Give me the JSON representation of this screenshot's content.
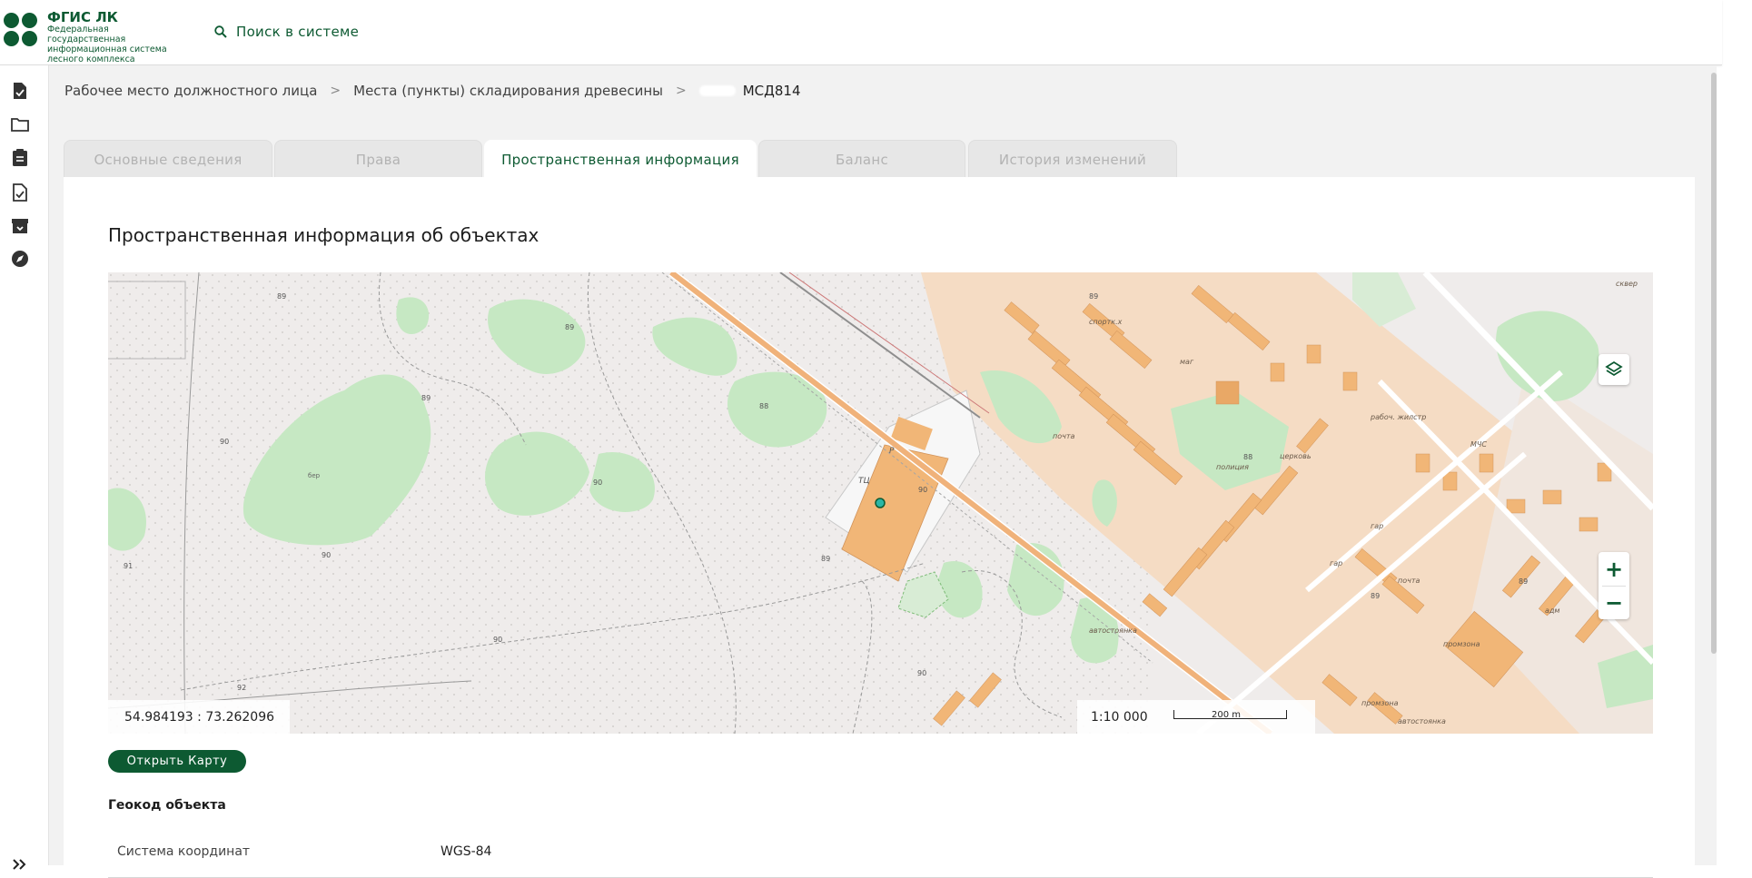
{
  "header": {
    "logo_title": "ФГИС ЛК",
    "logo_subtitle": "Федеральная государственная информационная система лесного комплекса",
    "search_label": "Поиск в системе"
  },
  "breadcrumb": {
    "items": [
      "Рабочее место должностного лица",
      "Места (пункты) складирования древесины"
    ],
    "current": "МСД814"
  },
  "tabs": [
    {
      "label": "Основные сведения",
      "active": false
    },
    {
      "label": "Права",
      "active": false
    },
    {
      "label": "Пространственная информация",
      "active": true
    },
    {
      "label": "Баланс",
      "active": false
    },
    {
      "label": "История изменений",
      "active": false
    }
  ],
  "section_title": "Пространственная информация об объектах",
  "map": {
    "coordinates": "54.984193 : 73.262096",
    "scale": "1:10 000",
    "scale_bar_label": "200 m",
    "zoom_in": "+",
    "zoom_out": "−",
    "labels": {
      "tc": "ТЦ",
      "p": "Р",
      "sportkh": "спортк.х",
      "mag": "маг",
      "pochta": "почта",
      "policiya": "полиция",
      "cerkov": "церковь",
      "rabochiy_zhiloy": "рабоч. жилстр",
      "avtostoyanka": "автостоянка",
      "promzona": "промзона",
      "adm": "адм",
      "gar": "гар",
      "MVS": "МЧС",
      "skver": "сквер",
      "ber": "бер",
      "h89": "89",
      "h90": "90",
      "h88": "88",
      "h91": "91",
      "h92": "92"
    },
    "colors": {
      "building": "#f1b677",
      "residential": "#f5dcc4",
      "park": "#c6e8c3",
      "land": "#efeceb",
      "marker": "#2ab6a6"
    }
  },
  "open_map_button": "Открыть Карту",
  "geocode": {
    "title": "Геокод объекта",
    "rows": [
      {
        "key": "Система координат",
        "value": "WGS-84"
      }
    ]
  },
  "sidebar": {
    "icons": [
      "document-check-icon",
      "folder-icon",
      "clipboard-icon",
      "file-check-icon",
      "archive-icon",
      "compass-icon"
    ],
    "expand_icon": "double-chevron-right-icon"
  }
}
